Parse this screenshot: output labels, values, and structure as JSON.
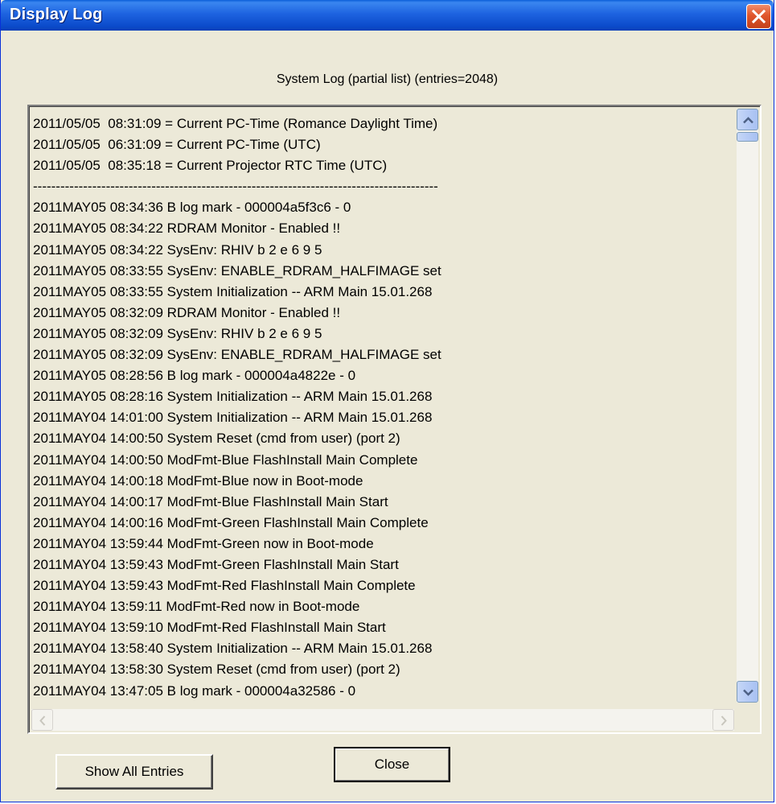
{
  "window": {
    "title": "Display Log",
    "close_icon": "close-x-icon"
  },
  "header": {
    "label": "System Log  (partial list)  (entries=2048)"
  },
  "log": {
    "lines": [
      "2011/05/05  08:31:09 = Current PC-Time (Romance Daylight Time)",
      "2011/05/05  06:31:09 = Current PC-Time (UTC)",
      "2011/05/05  08:35:18 = Current Projector RTC Time (UTC)",
      "-----------------------------------------------------------------------------------------",
      "2011MAY05 08:34:36 B log mark - 000004a5f3c6 - 0",
      "2011MAY05 08:34:22 RDRAM Monitor - Enabled !!",
      "2011MAY05 08:34:22 SysEnv: RHIV b 2 e 6 9 5",
      "2011MAY05 08:33:55 SysEnv: ENABLE_RDRAM_HALFIMAGE set",
      "2011MAY05 08:33:55 System Initialization -- ARM Main 15.01.268",
      "2011MAY05 08:32:09 RDRAM Monitor - Enabled !!",
      "2011MAY05 08:32:09 SysEnv: RHIV b 2 e 6 9 5",
      "2011MAY05 08:32:09 SysEnv: ENABLE_RDRAM_HALFIMAGE set",
      "2011MAY05 08:28:56 B log mark - 000004a4822e - 0",
      "2011MAY05 08:28:16 System Initialization -- ARM Main 15.01.268",
      "2011MAY04 14:01:00 System Initialization -- ARM Main 15.01.268",
      "2011MAY04 14:00:50 System Reset (cmd from user) (port 2)",
      "2011MAY04 14:00:50 ModFmt-Blue FlashInstall Main Complete",
      "2011MAY04 14:00:18 ModFmt-Blue now in Boot-mode",
      "2011MAY04 14:00:17 ModFmt-Blue FlashInstall Main Start",
      "2011MAY04 14:00:16 ModFmt-Green FlashInstall Main Complete",
      "2011MAY04 13:59:44 ModFmt-Green now in Boot-mode",
      "2011MAY04 13:59:43 ModFmt-Green FlashInstall Main Start",
      "2011MAY04 13:59:43 ModFmt-Red FlashInstall Main Complete",
      "2011MAY04 13:59:11 ModFmt-Red now in Boot-mode",
      "2011MAY04 13:59:10 ModFmt-Red FlashInstall Main Start",
      "2011MAY04 13:58:40 System Initialization -- ARM Main 15.01.268",
      "2011MAY04 13:58:30 System Reset (cmd from user) (port 2)",
      "2011MAY04 13:47:05 B log mark - 000004a32586 - 0"
    ]
  },
  "scrollbars": {
    "up_icon": "chevron-up-icon",
    "down_icon": "chevron-down-icon",
    "left_icon": "chevron-left-icon",
    "right_icon": "chevron-right-icon"
  },
  "buttons": {
    "show_all": "Show All Entries",
    "close": "Close"
  }
}
